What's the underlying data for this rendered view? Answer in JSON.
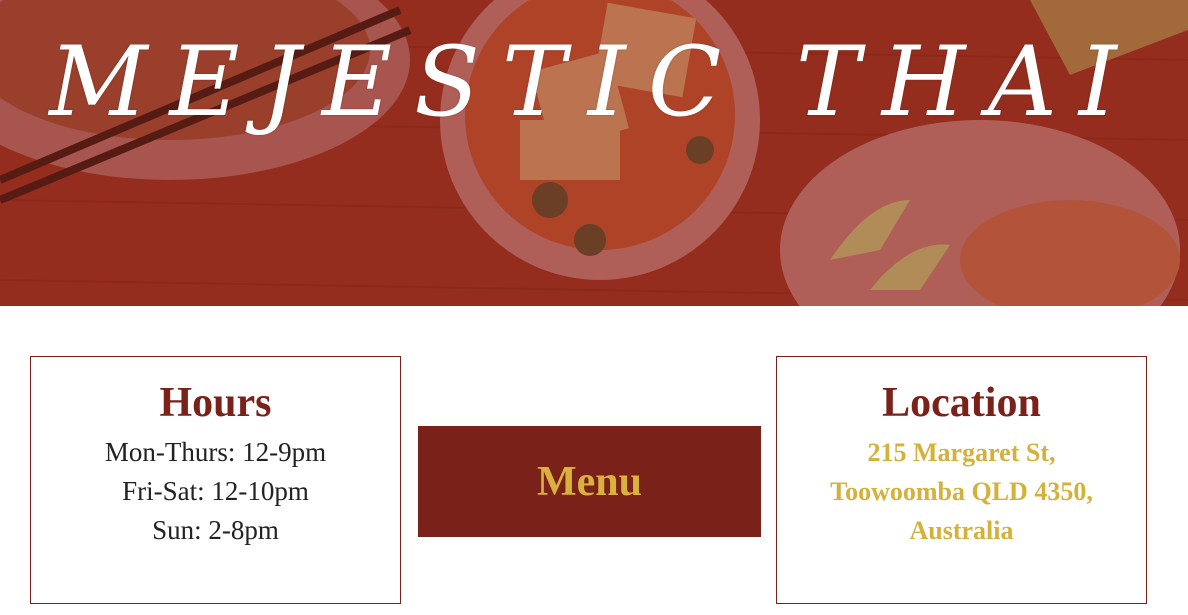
{
  "hero": {
    "title": "Mejestic Thai"
  },
  "hours": {
    "heading": "Hours",
    "lines": [
      "Mon-Thurs: 12-9pm",
      "Fri-Sat: 12-10pm",
      "Sun: 2-8pm"
    ]
  },
  "menu": {
    "label": "Menu"
  },
  "location": {
    "heading": "Location",
    "lines": [
      "215 Margaret St,",
      "Toowoomba QLD 4350,",
      "Australia"
    ]
  },
  "colors": {
    "brand_red": "#7a2219",
    "accent_gold": "#d4b13a",
    "hero_overlay": "#8a2a1c"
  }
}
